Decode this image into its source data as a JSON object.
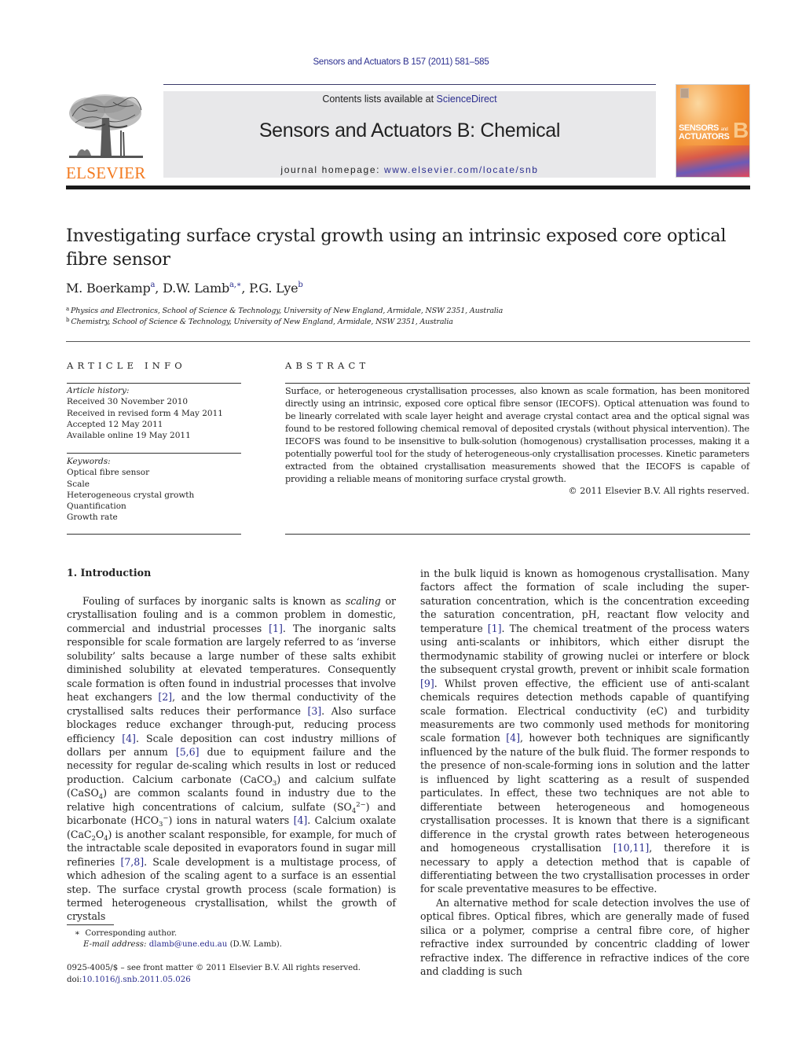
{
  "header": {
    "journal_reference": "Sensors and Actuators B 157 (2011) 581–585",
    "publisher_logo_text": "ELSEVIER",
    "contents_prefix": "Contents lists available at ",
    "contents_link": "ScienceDirect",
    "journal_title": "Sensors and Actuators B: Chemical",
    "homepage_prefix": "journal homepage: ",
    "homepage_link": "www.elsevier.com/locate/snb",
    "cover": {
      "line1": "SENSORS",
      "line1_small": "and",
      "line2": "ACTUATORS",
      "letter": "B",
      "colors": {
        "orange": "#f08a2a",
        "logo_orange": "#f37a1f",
        "link_blue": "#2b2e8f"
      }
    }
  },
  "article": {
    "title": "Investigating surface crystal growth using an intrinsic exposed core optical fibre sensor",
    "authors": [
      {
        "name": "M. Boerkamp",
        "marks": "a"
      },
      {
        "name": "D.W. Lamb",
        "marks": "a,∗"
      },
      {
        "name": "P.G. Lye",
        "marks": "b"
      }
    ],
    "affiliations": [
      {
        "mark": "a",
        "text": "Physics and Electronics, School of Science & Technology, University of New England, Armidale, NSW 2351, Australia"
      },
      {
        "mark": "b",
        "text": "Chemistry, School of Science & Technology, University of New England, Armidale, NSW 2351, Australia"
      }
    ]
  },
  "article_info": {
    "heading": "ARTICLE INFO",
    "history_label": "Article history:",
    "history": [
      "Received 30 November 2010",
      "Received in revised form 4 May 2011",
      "Accepted 12 May 2011",
      "Available online 19 May 2011"
    ],
    "keywords_label": "Keywords:",
    "keywords": [
      "Optical fibre sensor",
      "Scale",
      "Heterogeneous crystal growth",
      "Quantification",
      "Growth rate"
    ]
  },
  "abstract": {
    "heading": "ABSTRACT",
    "text": "Surface, or heterogeneous crystallisation processes, also known as scale formation, has been monitored directly using an intrinsic, exposed core optical fibre sensor (IECOFS). Optical attenuation was found to be linearly correlated with scale layer height and average crystal contact area and the optical signal was found to be restored following chemical removal of deposited crystals (without physical intervention). The IECOFS was found to be insensitive to bulk-solution (homogenous) crystallisation processes, making it a potentially powerful tool for the study of heterogeneous-only crystallisation processes. Kinetic parameters extracted from the obtained crystallisation measurements showed that the IECOFS is capable of providing a reliable means of monitoring surface crystal growth.",
    "copyright": "© 2011 Elsevier B.V. All rights reserved."
  },
  "introduction": {
    "heading": "1.  Introduction",
    "col1": {
      "s1": "Fouling of surfaces by inorganic salts is known as ",
      "s1_em": "scaling",
      "s2": " or crystallisation fouling and is a common problem in domestic, commercial and industrial processes ",
      "r1": "[1]",
      "s3": ". The inorganic salts responsible for scale formation are largely referred to as ‘inverse solubility’ salts because a large number of these salts exhibit diminished solubility at elevated temperatures. Consequently scale formation is often found in industrial processes that involve heat exchangers ",
      "r2": "[2]",
      "s4": ", and the low thermal conductivity of the crystallised salts reduces their performance ",
      "r3": "[3]",
      "s5": ". Also surface blockages reduce exchanger through-put, reducing process efficiency ",
      "r4": "[4]",
      "s6": ". Scale deposition can cost industry millions of dollars per annum ",
      "r5": "[5,6]",
      "s7": " due to equipment failure and the necessity for regular de-scaling which results in lost or reduced production. Calcium carbonate (CaCO",
      "sub1": "3",
      "s8": ") and calcium sulfate (CaSO",
      "sub2": "4",
      "s9": ") are common scalants found in industry due to the relative high concentrations of calcium, sulfate (SO",
      "sub3": "4",
      "sup3": "2−",
      "s10": ") and bicarbonate (HCO",
      "sub4": "3",
      "sup4": "−",
      "s11": ") ions in natural waters ",
      "r6": "[4]",
      "s12": ". Calcium oxalate (CaC",
      "sub5": "2",
      "s13": "O",
      "sub6": "4",
      "s14": ") is another scalant responsible, for example, for much of the intractable scale deposited in evaporators found in sugar mill refineries ",
      "r7": "[7,8]",
      "s15": ". Scale development is a multistage process, of which adhesion of the scaling agent to a surface is an essential step. The surface crystal growth process (scale formation) is termed heterogeneous crystallisation, whilst the growth of crystals"
    },
    "col2": {
      "p1_s1": "in the bulk liquid is known as homogenous crystallisation. Many factors affect the formation of scale including the super-saturation concentration, which is the concentration exceeding the saturation concentration, pH, reactant flow velocity and temperature ",
      "p1_r1": "[1]",
      "p1_s2": ". The chemical treatment of the process waters using anti-scalants or inhibitors, which either disrupt the thermodynamic stability of growing nuclei or interfere or block the subsequent crystal growth, prevent or inhibit scale formation ",
      "p1_r2": "[9]",
      "p1_s3": ". Whilst proven effective, the efficient use of anti-scalant chemicals requires detection methods capable of quantifying scale formation. Electrical conductivity (eC) and turbidity measurements are two commonly used methods for monitoring scale formation ",
      "p1_r3": "[4]",
      "p1_s4": ", however both techniques are significantly influenced by the nature of the bulk fluid. The former responds to the presence of non-scale-forming ions in solution and the latter is influenced by light scattering as a result of suspended particulates. In effect, these two techniques are not able to differentiate between heterogeneous and homogeneous crystallisation processes. It is known that there is a significant difference in the crystal growth rates between heterogeneous and homogeneous crystallisation ",
      "p1_r4": "[10,11]",
      "p1_s5": ", therefore it is necessary to apply a detection method that is capable of differentiating between the two crystallisation processes in order for scale preventative measures to be effective.",
      "p2": "An alternative method for scale detection involves the use of optical fibres. Optical fibres, which are generally made of fused silica or a polymer, comprise a central fibre core, of higher refractive index surrounded by concentric cladding of lower refractive index. The difference in refractive indices of the core and cladding is such"
    }
  },
  "footnotes": {
    "corresponding_mark": "∗",
    "corresponding": "Corresponding author.",
    "email_label": "E-mail address:",
    "email": "dlamb@une.edu.au",
    "email_suffix": " (D.W. Lamb).",
    "front_matter": "0925-4005/$ – see front matter © 2011 Elsevier B.V. All rights reserved.",
    "doi_prefix": "doi:",
    "doi": "10.1016/j.snb.2011.05.026"
  }
}
